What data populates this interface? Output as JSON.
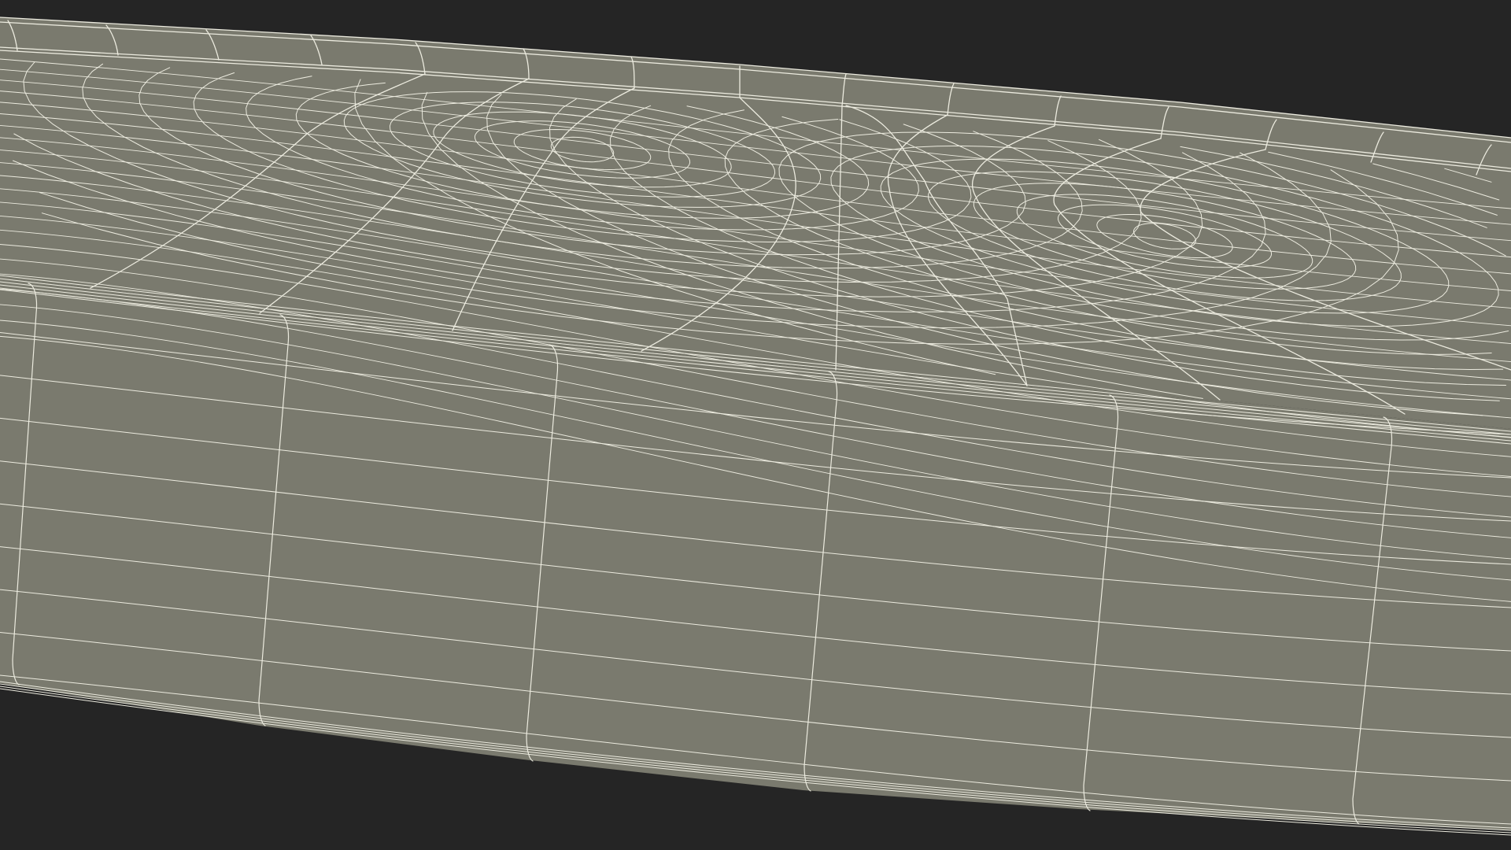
{
  "scene": {
    "background_color": "#252525",
    "surface_color": "#7a7a6e",
    "wire_color": "#ecebdf",
    "object": "wireframe-cylindrical-slab"
  }
}
